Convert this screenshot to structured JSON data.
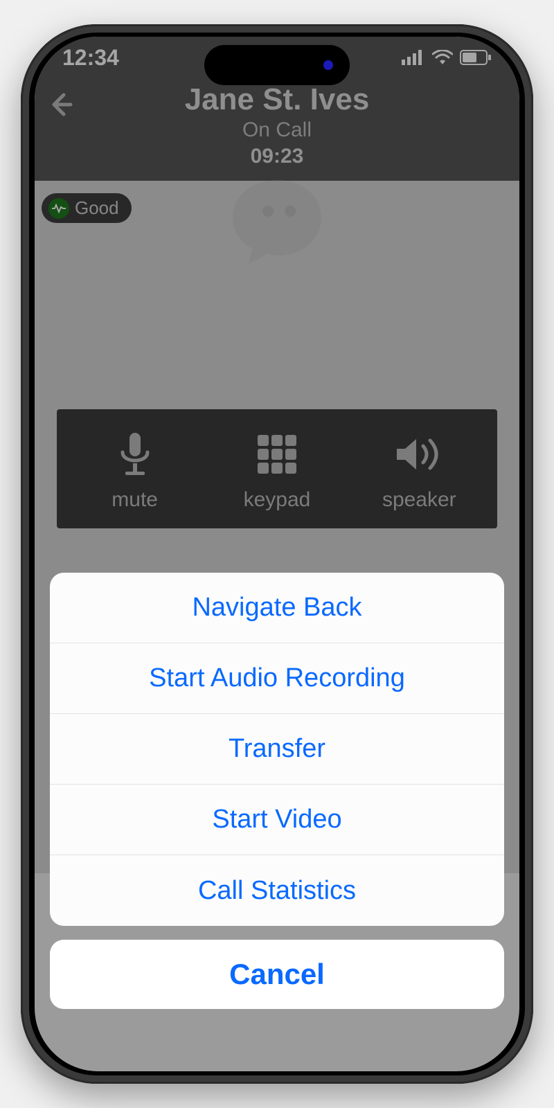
{
  "statusbar": {
    "time": "12:34"
  },
  "header": {
    "contact_name": "Jane St. Ives",
    "call_status": "On Call",
    "timer": "09:23"
  },
  "quality": {
    "label": "Good"
  },
  "controls": {
    "mute": "mute",
    "keypad": "keypad",
    "speaker": "speaker"
  },
  "sheet": {
    "items": [
      "Navigate Back",
      "Start Audio Recording",
      "Transfer",
      "Start Video",
      "Call Statistics"
    ],
    "cancel": "Cancel"
  }
}
